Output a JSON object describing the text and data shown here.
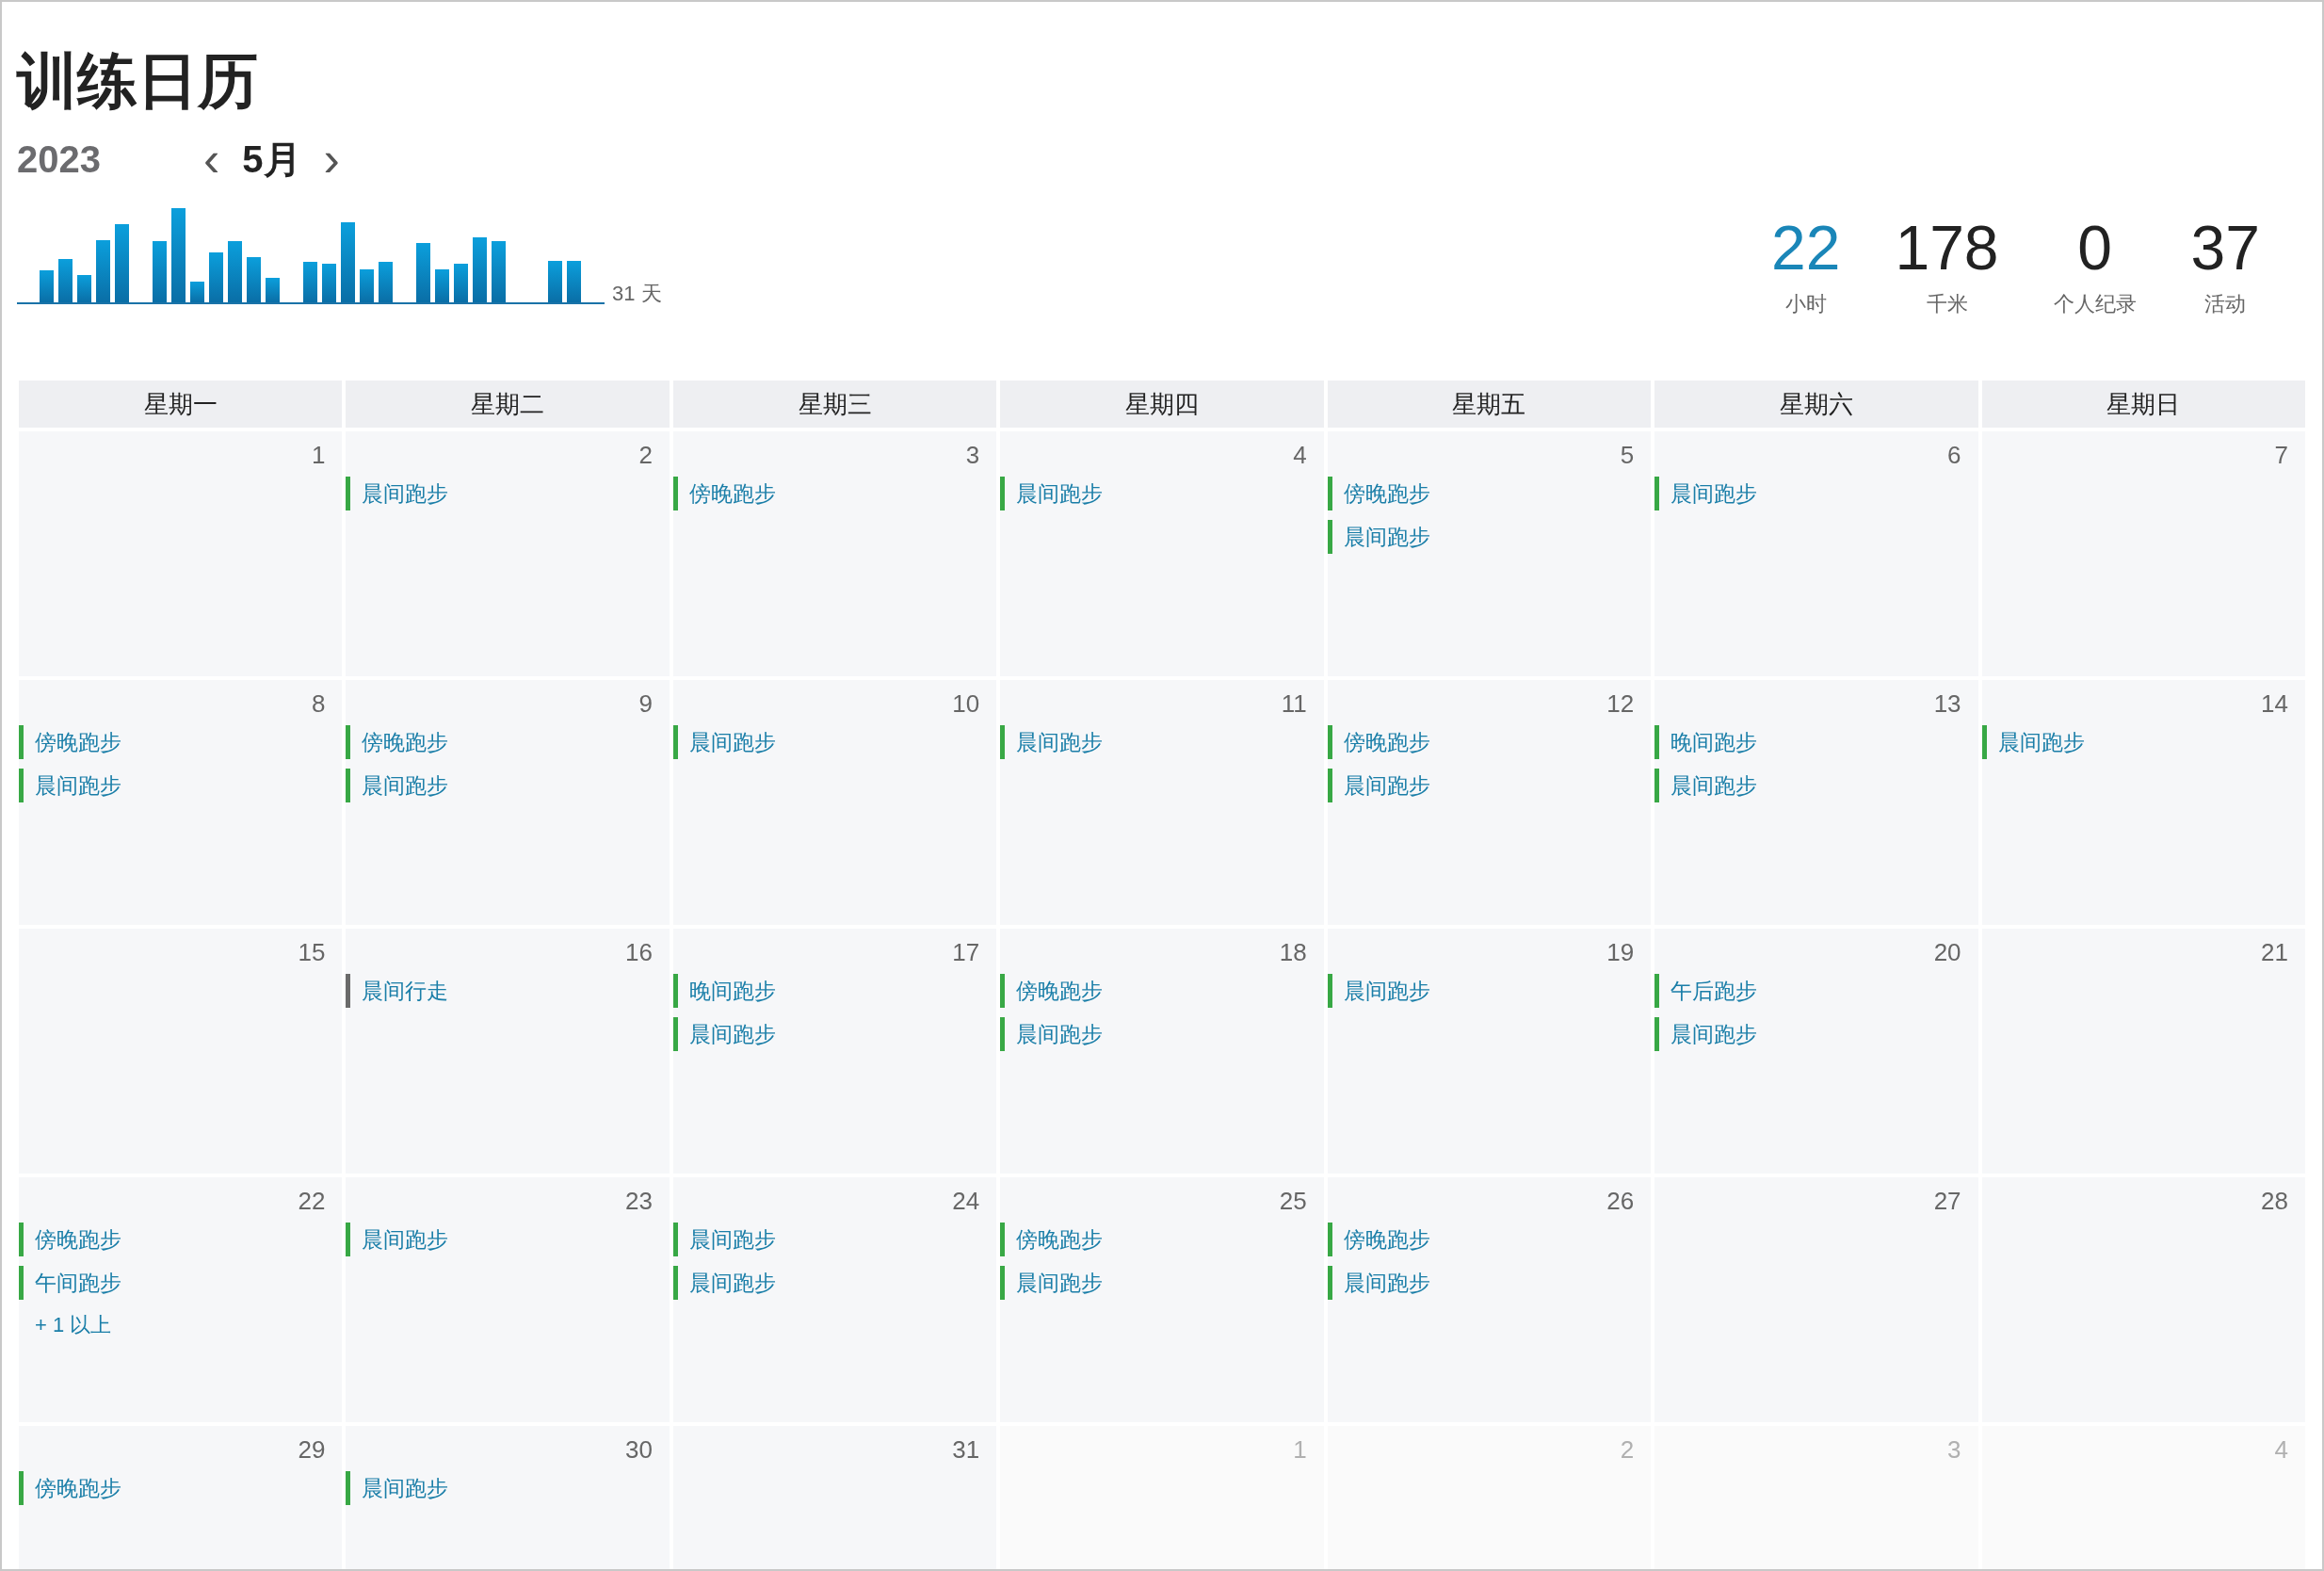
{
  "title": "训练日历",
  "year": "2023",
  "month": "5月",
  "prev_button": "‹",
  "next_button": "›",
  "chart_caption": "31 天",
  "stats": [
    {
      "value": "22",
      "label": "小时",
      "highlighted": true
    },
    {
      "value": "178",
      "label": "千米",
      "highlighted": false
    },
    {
      "value": "0",
      "label": "个人纪录",
      "highlighted": false
    },
    {
      "value": "37",
      "label": "活动",
      "highlighted": false
    }
  ],
  "weekdays": [
    "星期一",
    "星期二",
    "星期三",
    "星期四",
    "星期五",
    "星期六",
    "星期日"
  ],
  "weeks": [
    {
      "days": [
        {
          "date": "1",
          "outside_month": false
        },
        {
          "date": "2",
          "outside_month": false,
          "events": [
            {
              "label": "晨间跑步",
              "kind": "run"
            }
          ]
        },
        {
          "date": "3",
          "outside_month": false,
          "events": [
            {
              "label": "傍晚跑步",
              "kind": "run"
            }
          ]
        },
        {
          "date": "4",
          "outside_month": false,
          "events": [
            {
              "label": "晨间跑步",
              "kind": "run"
            }
          ]
        },
        {
          "date": "5",
          "outside_month": false,
          "events": [
            {
              "label": "傍晚跑步",
              "kind": "run"
            },
            {
              "label": "晨间跑步",
              "kind": "run"
            }
          ]
        },
        {
          "date": "6",
          "outside_month": false,
          "events": [
            {
              "label": "晨间跑步",
              "kind": "run"
            }
          ]
        },
        {
          "date": "7",
          "outside_month": false
        }
      ]
    },
    {
      "days": [
        {
          "date": "8",
          "outside_month": false,
          "events": [
            {
              "label": "傍晚跑步",
              "kind": "run"
            },
            {
              "label": "晨间跑步",
              "kind": "run"
            }
          ]
        },
        {
          "date": "9",
          "outside_month": false,
          "events": [
            {
              "label": "傍晚跑步",
              "kind": "run"
            },
            {
              "label": "晨间跑步",
              "kind": "run"
            }
          ]
        },
        {
          "date": "10",
          "outside_month": false,
          "events": [
            {
              "label": "晨间跑步",
              "kind": "run"
            }
          ]
        },
        {
          "date": "11",
          "outside_month": false,
          "events": [
            {
              "label": "晨间跑步",
              "kind": "run"
            }
          ]
        },
        {
          "date": "12",
          "outside_month": false,
          "events": [
            {
              "label": "傍晚跑步",
              "kind": "run"
            },
            {
              "label": "晨间跑步",
              "kind": "run"
            }
          ]
        },
        {
          "date": "13",
          "outside_month": false,
          "events": [
            {
              "label": "晚间跑步",
              "kind": "run"
            },
            {
              "label": "晨间跑步",
              "kind": "run"
            }
          ]
        },
        {
          "date": "14",
          "outside_month": false,
          "events": [
            {
              "label": "晨间跑步",
              "kind": "run"
            }
          ]
        }
      ]
    },
    {
      "days": [
        {
          "date": "15",
          "outside_month": false
        },
        {
          "date": "16",
          "outside_month": false,
          "events": [
            {
              "label": "晨间行走",
              "kind": "walk"
            }
          ]
        },
        {
          "date": "17",
          "outside_month": false,
          "events": [
            {
              "label": "晚间跑步",
              "kind": "run"
            },
            {
              "label": "晨间跑步",
              "kind": "run"
            }
          ]
        },
        {
          "date": "18",
          "outside_month": false,
          "events": [
            {
              "label": "傍晚跑步",
              "kind": "run"
            },
            {
              "label": "晨间跑步",
              "kind": "run"
            }
          ]
        },
        {
          "date": "19",
          "outside_month": false,
          "events": [
            {
              "label": "晨间跑步",
              "kind": "run"
            }
          ]
        },
        {
          "date": "20",
          "outside_month": false,
          "events": [
            {
              "label": "午后跑步",
              "kind": "run"
            },
            {
              "label": "晨间跑步",
              "kind": "run"
            }
          ]
        },
        {
          "date": "21",
          "outside_month": false
        }
      ]
    },
    {
      "days": [
        {
          "date": "22",
          "outside_month": false,
          "events": [
            {
              "label": "傍晚跑步",
              "kind": "run"
            },
            {
              "label": "午间跑步",
              "kind": "run"
            }
          ],
          "more": "+ 1 以上"
        },
        {
          "date": "23",
          "outside_month": false,
          "events": [
            {
              "label": "晨间跑步",
              "kind": "run"
            }
          ]
        },
        {
          "date": "24",
          "outside_month": false,
          "events": [
            {
              "label": "晨间跑步",
              "kind": "run"
            },
            {
              "label": "晨间跑步",
              "kind": "run"
            }
          ]
        },
        {
          "date": "25",
          "outside_month": false,
          "events": [
            {
              "label": "傍晚跑步",
              "kind": "run"
            },
            {
              "label": "晨间跑步",
              "kind": "run"
            }
          ]
        },
        {
          "date": "26",
          "outside_month": false,
          "events": [
            {
              "label": "傍晚跑步",
              "kind": "run"
            },
            {
              "label": "晨间跑步",
              "kind": "run"
            }
          ]
        },
        {
          "date": "27",
          "outside_month": false
        },
        {
          "date": "28",
          "outside_month": false
        }
      ]
    },
    {
      "days": [
        {
          "date": "29",
          "outside_month": false,
          "events": [
            {
              "label": "傍晚跑步",
              "kind": "run"
            }
          ]
        },
        {
          "date": "30",
          "outside_month": false,
          "events": [
            {
              "label": "晨间跑步",
              "kind": "run"
            }
          ]
        },
        {
          "date": "31",
          "outside_month": false
        },
        {
          "date": "1",
          "outside_month": true
        },
        {
          "date": "2",
          "outside_month": true
        },
        {
          "date": "3",
          "outside_month": true
        },
        {
          "date": "4",
          "outside_month": true
        }
      ]
    }
  ]
}
